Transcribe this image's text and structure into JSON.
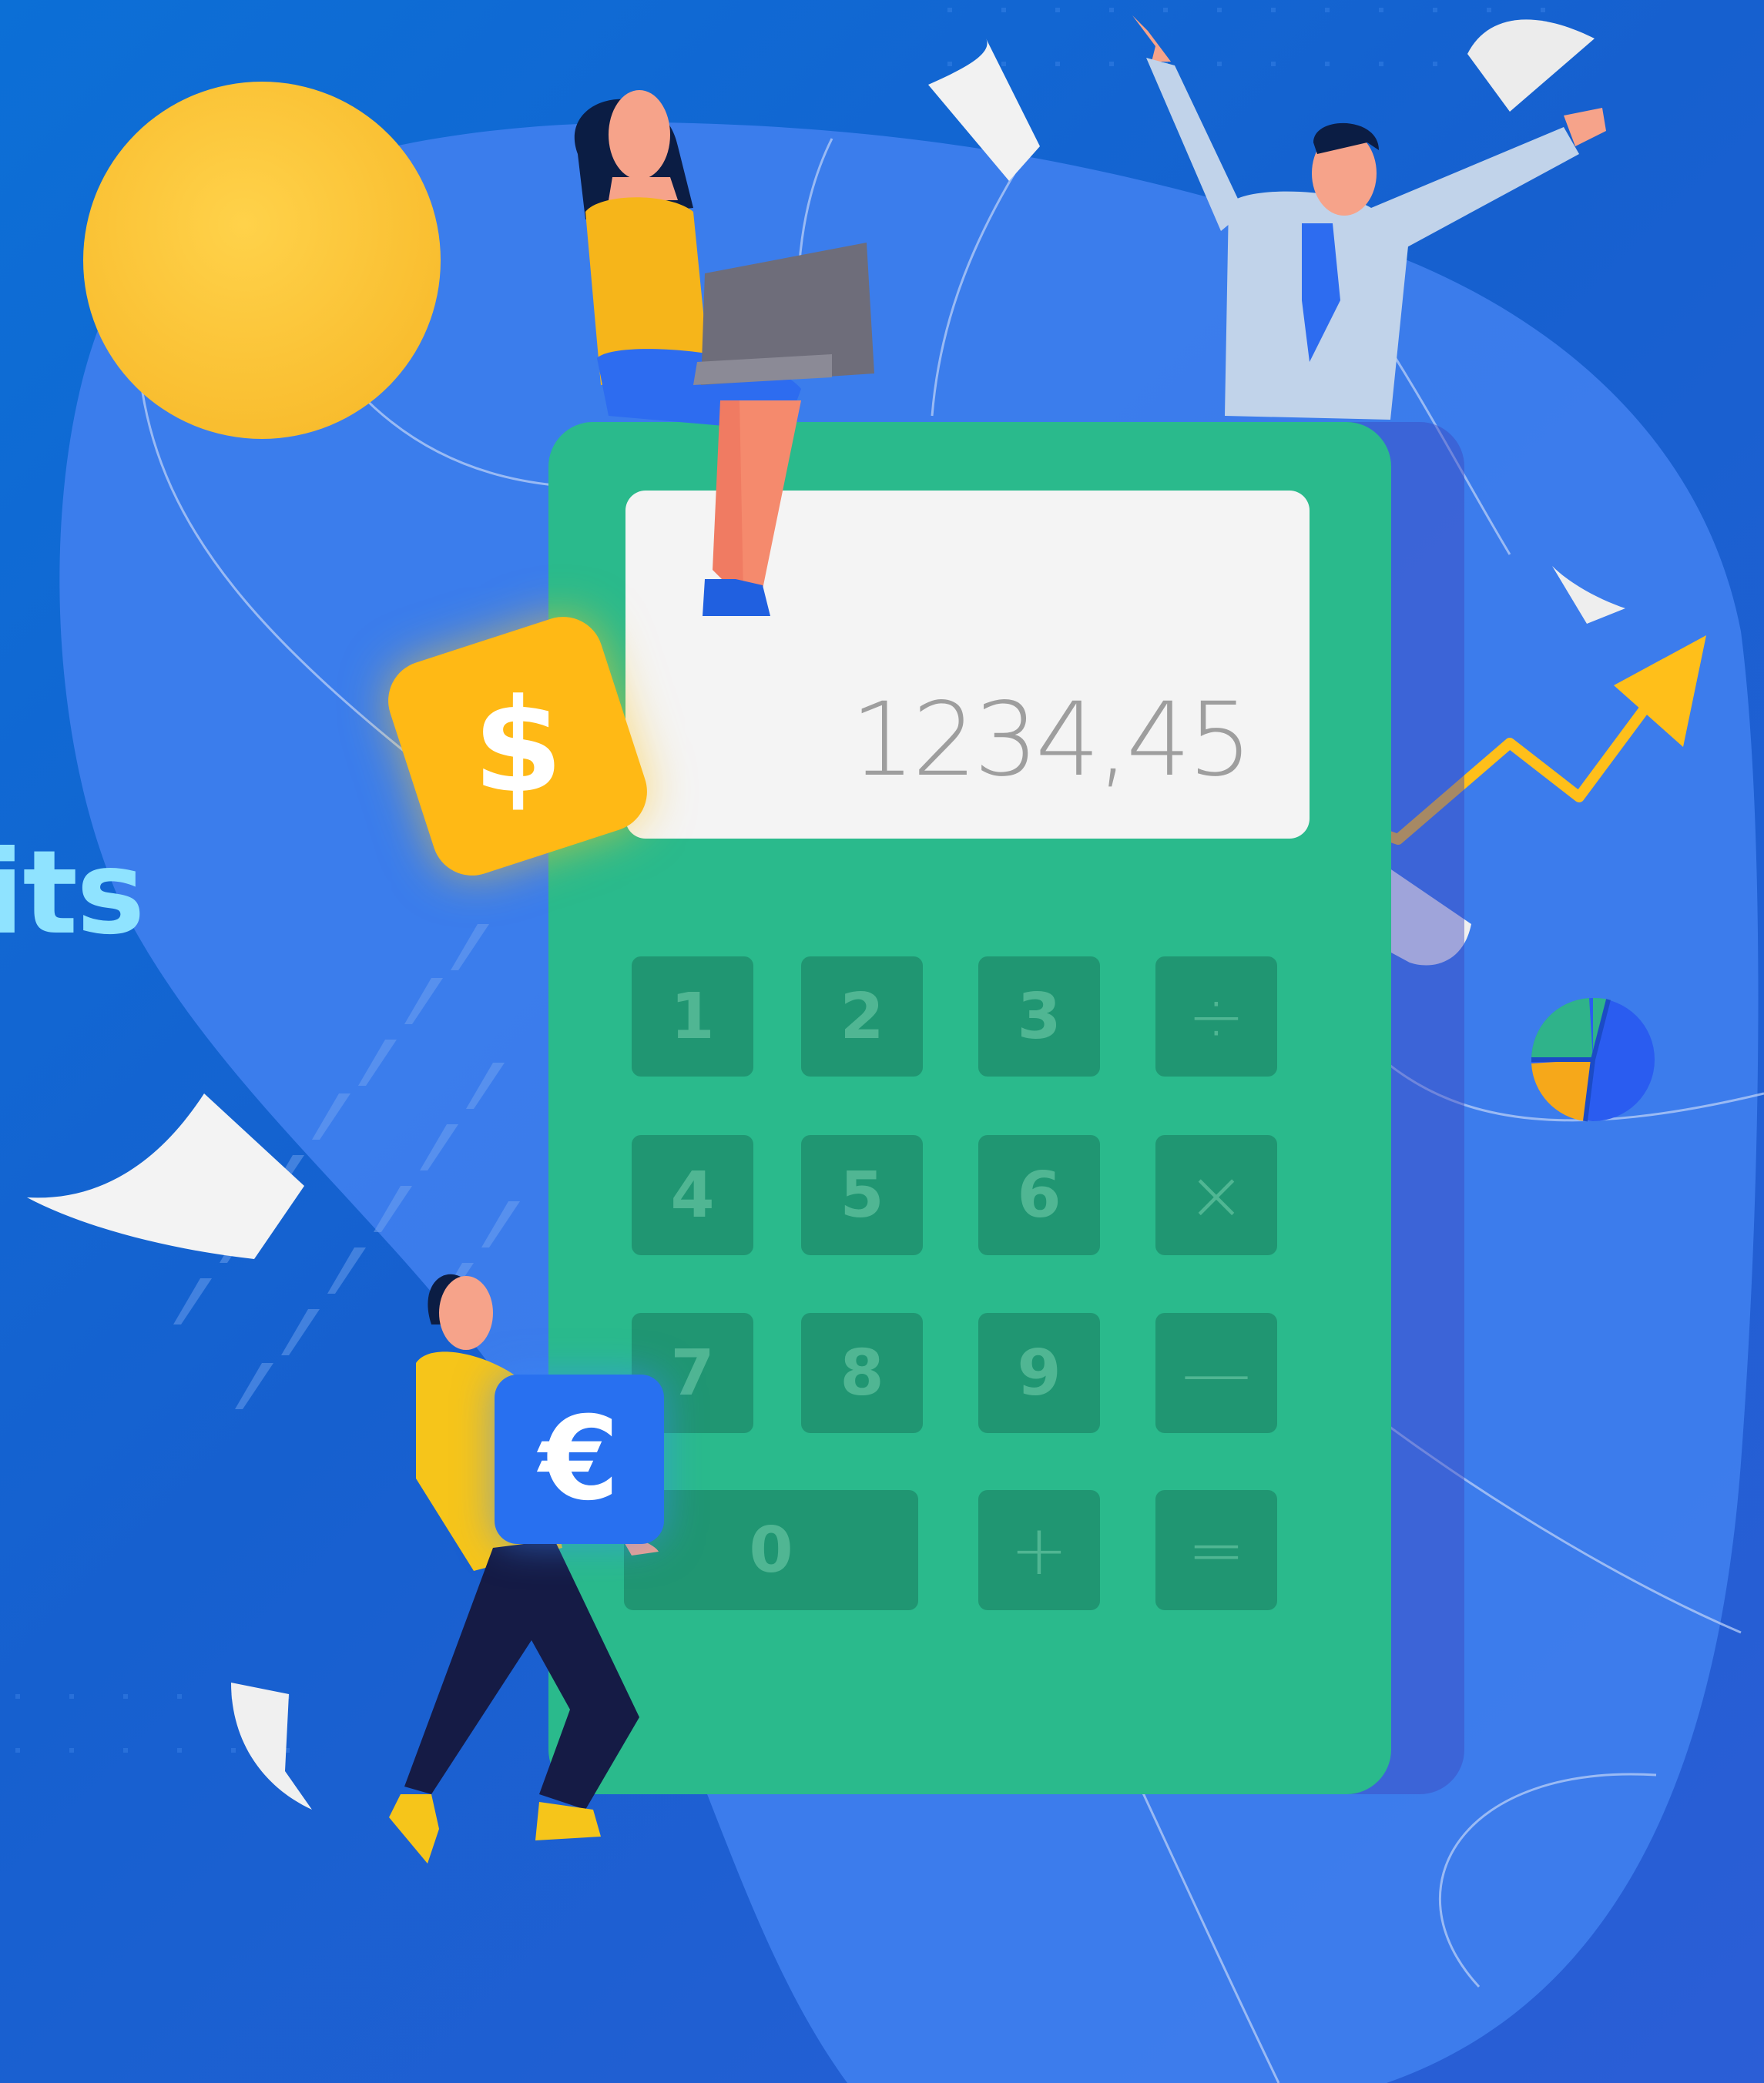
{
  "headline": {
    "fragment": "its"
  },
  "calculator": {
    "display": "1234,45",
    "keys": [
      {
        "label": "1",
        "name": "key-1"
      },
      {
        "label": "2",
        "name": "key-2"
      },
      {
        "label": "3",
        "name": "key-3"
      },
      {
        "label": "÷",
        "name": "key-divide"
      },
      {
        "label": "4",
        "name": "key-4"
      },
      {
        "label": "5",
        "name": "key-5"
      },
      {
        "label": "6",
        "name": "key-6"
      },
      {
        "label": "×",
        "name": "key-multiply"
      },
      {
        "label": "7",
        "name": "key-7"
      },
      {
        "label": "8",
        "name": "key-8"
      },
      {
        "label": "9",
        "name": "key-9"
      },
      {
        "label": "—",
        "name": "key-subtract"
      },
      {
        "label": "0",
        "name": "key-0"
      },
      {
        "label": "+",
        "name": "key-add"
      },
      {
        "label": "=",
        "name": "key-equals"
      }
    ]
  },
  "badges": {
    "dollar": "$",
    "euro": "€"
  },
  "colors": {
    "background": "#1366d2",
    "blob": "#3f7fee",
    "calculator": "#2aba8c",
    "display": "#f4f4f4",
    "sun": "#ffc93a",
    "accent_yellow": "#ffb915",
    "headline": "#8fe3ff"
  },
  "icons": [
    "sun-icon",
    "dollar-coin-icon",
    "euro-coin-icon",
    "growth-arrow-icon",
    "pie-chart-icon",
    "paper-sheet-icon"
  ]
}
